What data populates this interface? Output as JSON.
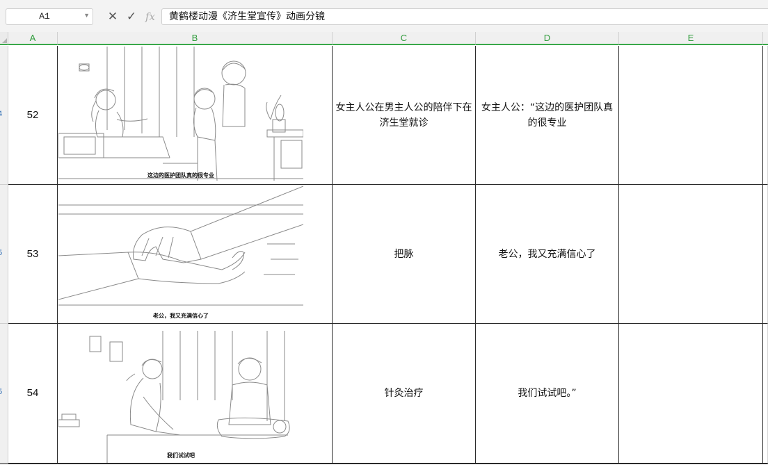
{
  "formula_bar": {
    "cell_ref": "A1",
    "fx_label": "fx",
    "cancel_glyph": "✕",
    "enter_glyph": "✓",
    "content": "黄鹤楼动漫《济生堂宣传》动画分镜"
  },
  "columns": [
    "A",
    "B",
    "C",
    "D",
    "E"
  ],
  "row_headers": [
    "4",
    "5",
    "5"
  ],
  "rows": [
    {
      "num": "52",
      "desc": "女主人公在男主人公的陪伴下在济生堂就诊",
      "dialog": "女主人公：“这边的医护团队真的很专业",
      "caption": "这边的医护团队真的很专业"
    },
    {
      "num": "53",
      "desc": "把脉",
      "dialog": "老公，我又充满信心了",
      "caption": "老公，我又充满信心了"
    },
    {
      "num": "54",
      "desc": "针灸治疗",
      "dialog": "我们试试吧。”",
      "caption": "我们试试吧"
    }
  ],
  "colors": {
    "header_green": "#2e9b3a",
    "grid": "#2a2a2a"
  }
}
